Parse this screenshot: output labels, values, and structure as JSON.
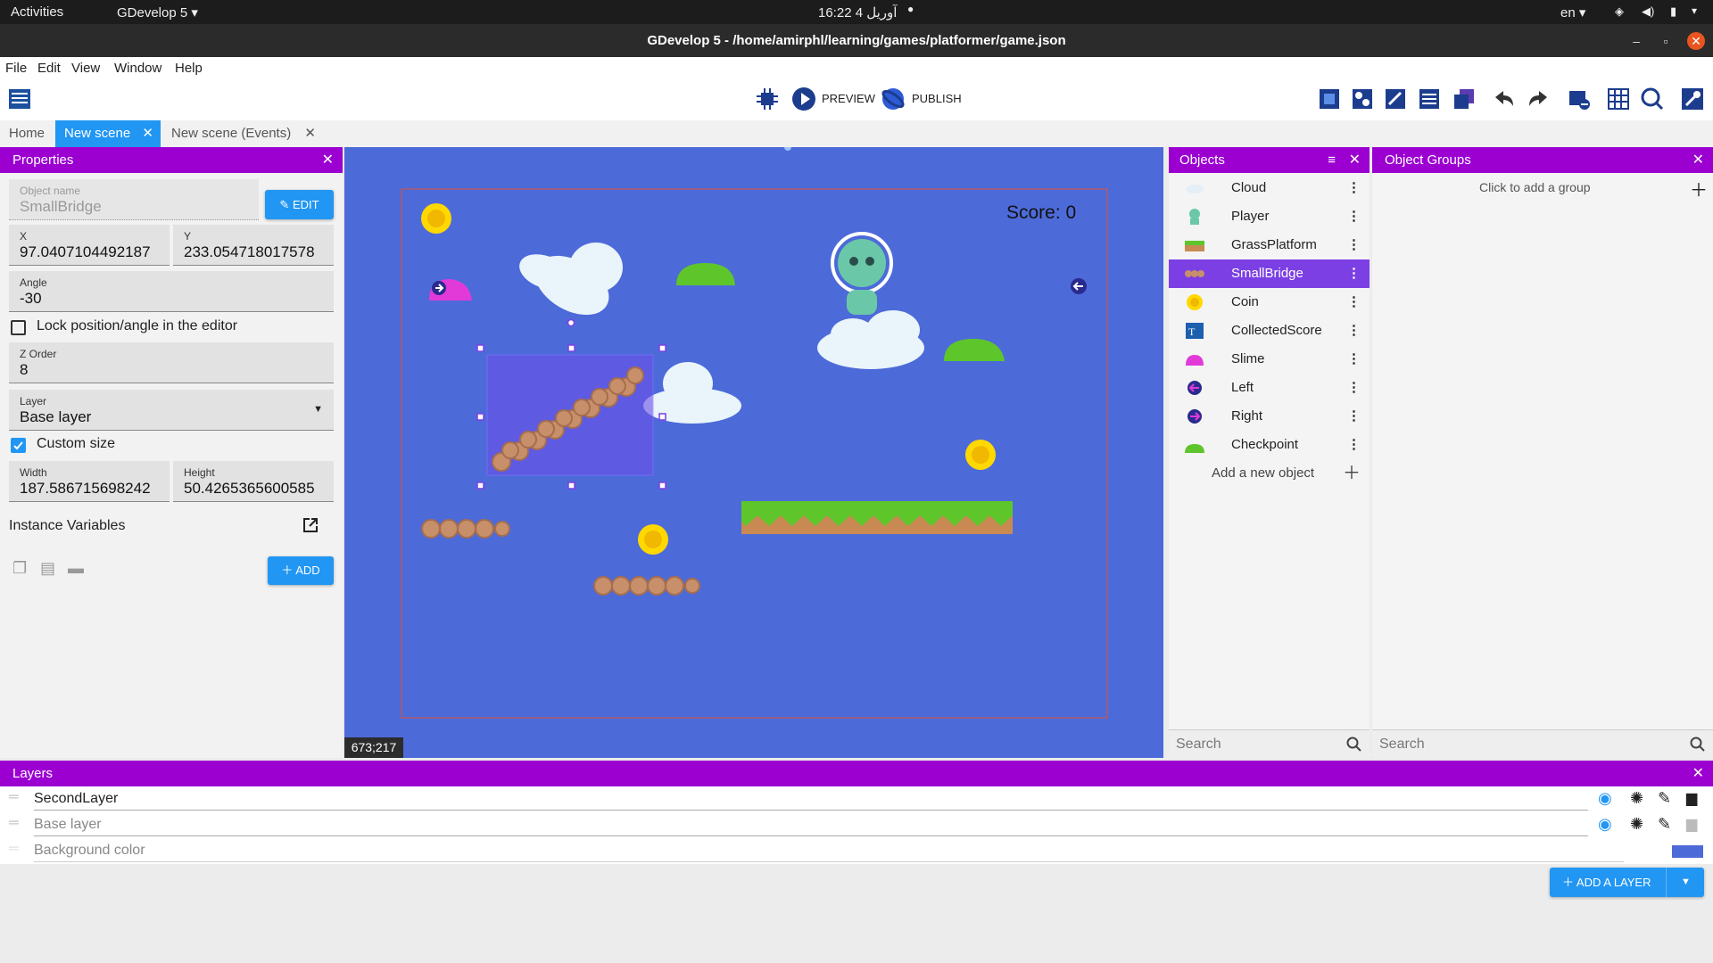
{
  "system": {
    "activities": "Activities",
    "app_menu": "GDevelop 5 ▾",
    "clock": "16:22  آوریل 4",
    "lang": "en ▾"
  },
  "window": {
    "title": "GDevelop 5 - /home/amirphl/learning/games/platformer/game.json"
  },
  "menu": [
    "File",
    "Edit",
    "View",
    "Window",
    "Help"
  ],
  "toolbar": {
    "preview_label": "PREVIEW",
    "publish_label": "PUBLISH"
  },
  "tabs": [
    {
      "label": "Home"
    },
    {
      "label": "New scene",
      "active": true
    },
    {
      "label": "New scene (Events)"
    }
  ],
  "properties": {
    "title": "Properties",
    "object_name_label": "Object name",
    "object_name": "SmallBridge",
    "edit_label": "EDIT",
    "x_label": "X",
    "x_value": "97.0407104492187",
    "y_label": "Y",
    "y_value": "233.054718017578",
    "angle_label": "Angle",
    "angle_value": "-30",
    "lock_label": "Lock position/angle in the editor",
    "lock_checked": false,
    "z_label": "Z Order",
    "z_value": "8",
    "layer_label": "Layer",
    "layer_value": "Base layer",
    "custom_size_label": "Custom size",
    "custom_size_checked": true,
    "width_label": "Width",
    "width_value": "187.586715698242",
    "height_label": "Height",
    "height_value": "50.4265365600585",
    "instance_vars_label": "Instance Variables",
    "add_label": "ADD"
  },
  "scene": {
    "score_text": "Score: 0",
    "coords": "673;217",
    "bg_color": "#4d6ad9"
  },
  "objects": {
    "title": "Objects",
    "items": [
      {
        "name": "Cloud",
        "icon": "cloud-icon"
      },
      {
        "name": "Player",
        "icon": "player-icon"
      },
      {
        "name": "GrassPlatform",
        "icon": "grass-platform-icon"
      },
      {
        "name": "SmallBridge",
        "icon": "bridge-icon",
        "selected": true
      },
      {
        "name": "Coin",
        "icon": "coin-icon"
      },
      {
        "name": "CollectedScore",
        "icon": "text-object-icon"
      },
      {
        "name": "Slime",
        "icon": "slime-icon"
      },
      {
        "name": "Left",
        "icon": "left-arrow-icon"
      },
      {
        "name": "Right",
        "icon": "right-arrow-icon"
      },
      {
        "name": "Checkpoint",
        "icon": "checkpoint-icon"
      }
    ],
    "add_label": "Add a new object",
    "search_placeholder": "Search"
  },
  "groups": {
    "title": "Object Groups",
    "add_label": "Click to add a group",
    "search_placeholder": "Search"
  },
  "layers": {
    "title": "Layers",
    "items": [
      {
        "name": "SecondLayer"
      },
      {
        "name": "Base layer"
      },
      {
        "name": "Background color"
      }
    ],
    "add_label": "ADD A LAYER"
  },
  "colors": {
    "accent": "#9b00d1",
    "button_blue": "#2196f3",
    "selected_row": "#7b3fe4"
  }
}
